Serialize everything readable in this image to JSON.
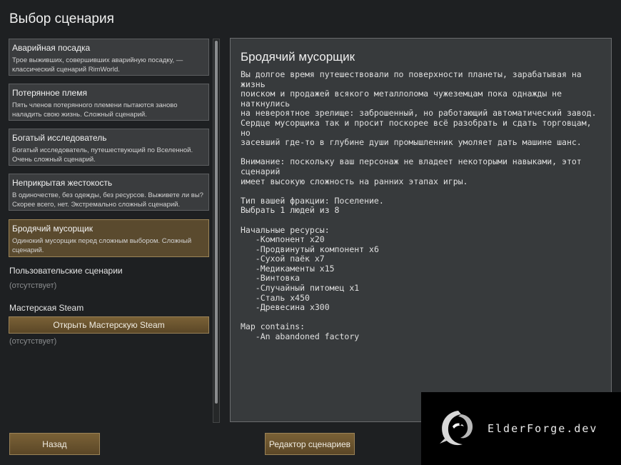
{
  "page": {
    "title": "Выбор сценария"
  },
  "scenarios": [
    {
      "name": "Аварийная посадка",
      "description": "Трое выживших, совершивших аварийную посадку, — классический сценарий RimWorld."
    },
    {
      "name": "Потерянное племя",
      "description": "Пять членов потерянного племени пытаются заново наладить свою жизнь. Сложный сценарий."
    },
    {
      "name": "Богатый исследователь",
      "description": "Богатый исследователь, путешествующий по Вселенной. Очень сложный сценарий."
    },
    {
      "name": "Неприкрытая жестокость",
      "description": "В одиночестве, без одежды, без ресурсов. Выживете ли вы? Скорее всего, нет. Экстремально сложный сценарий."
    },
    {
      "name": "Бродячий мусорщик",
      "description": "Одинокий мусорщик перед сложным выбором. Сложный сценарий.",
      "selected": true
    }
  ],
  "custom": {
    "label": "Пользовательские сценарии",
    "empty": "(отсутствует)"
  },
  "workshop": {
    "label": "Мастерская Steam",
    "button": "Открыть Мастерскую Steam",
    "empty": "(отсутствует)"
  },
  "detail": {
    "title": "Бродячий мусорщик",
    "text": "Вы долгое время путешествовали по поверхности планеты, зарабатывая на жизнь\nпоиском и продажей всякого металлолома чужеземцам пока однажды не наткнулись\nна невероятное зрелище: заброшенный, но работающий автоматический завод.\nСердце мусорщика так и просит поскорее всё разобрать и сдать торговцам, но\nзасевший где-то в глубине души промышленник умоляет дать машине шанс.\n\nВнимание: поскольку ваш персонаж не владеет некоторыми навыками, этот сценарий\nимеет высокую сложность на ранних этапах игры.\n\nТип вашей фракции: Поселение.\nВыбрать 1 людей из 8\n\nНачальные ресурсы:\n   -Компонент x20\n   -Продвинутый компонент x6\n   -Сухой паёк x7\n   -Медикаменты x15\n   -Винтовка\n   -Случайный питомец x1\n   -Сталь x450\n   -Древесина x300\n\nMap contains:\n   -An abandoned factory"
  },
  "buttons": {
    "back": "Назад",
    "editor": "Редактор сценариев"
  },
  "watermark": {
    "text": "ElderForge.dev",
    "logo_icon": "dragon-logo-icon"
  },
  "colors": {
    "selected_bg": "#5a4a2e",
    "button_bg": "#6b5430",
    "panel_bg": "#373a3c"
  }
}
